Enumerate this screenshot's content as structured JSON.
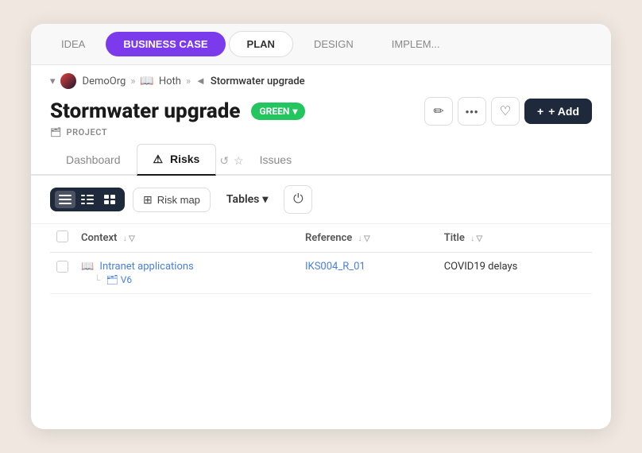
{
  "topNav": {
    "tabs": [
      {
        "id": "idea",
        "label": "IDEA",
        "active": false,
        "plan": false
      },
      {
        "id": "business-case",
        "label": "BUSINESS CASE",
        "active": true,
        "plan": false
      },
      {
        "id": "plan",
        "label": "PLAN",
        "active": false,
        "plan": true
      },
      {
        "id": "design",
        "label": "DESIGN",
        "active": false,
        "plan": false
      },
      {
        "id": "implement",
        "label": "IMPLEM...",
        "active": false,
        "plan": false
      }
    ]
  },
  "breadcrumb": {
    "org": "DemoOrg",
    "sep1": "»",
    "book_icon": "📖",
    "project_group": "Hoth",
    "sep2": "»",
    "arrow": "◄",
    "current": "Stormwater upgrade"
  },
  "project": {
    "title": "Stormwater upgrade",
    "status": "GREEN",
    "type": "PROJECT",
    "type_icon": "🗂"
  },
  "headerButtons": {
    "edit_icon": "✏",
    "more_icon": "•••",
    "bookmark_icon": "♡",
    "add_label": "+ Add"
  },
  "subTabs": {
    "tabs": [
      {
        "id": "dashboard",
        "label": "Dashboard",
        "active": false,
        "icon": ""
      },
      {
        "id": "risks",
        "label": "Risks",
        "active": true,
        "icon": "⚠"
      },
      {
        "id": "issues",
        "label": "Issues",
        "active": false,
        "icon": ""
      }
    ],
    "actions": [
      "↺",
      "☆"
    ]
  },
  "toolbar": {
    "views": [
      "≡",
      "☰",
      "▦"
    ],
    "riskmap_label": "Risk map",
    "tables_label": "Tables",
    "riskmap_icon": "⊞",
    "power_icon": "⏻"
  },
  "table": {
    "columns": [
      {
        "id": "checkbox",
        "label": ""
      },
      {
        "id": "context",
        "label": "Context"
      },
      {
        "id": "reference",
        "label": "Reference"
      },
      {
        "id": "title",
        "label": "Title"
      }
    ],
    "rows": [
      {
        "checkbox": false,
        "context_icon": "📖",
        "context_text": "Intranet applications",
        "sub_context_icon": "🗂",
        "sub_context_text": "V6",
        "reference": "IKS004_R_01",
        "title": "COVID19 delays"
      }
    ]
  }
}
